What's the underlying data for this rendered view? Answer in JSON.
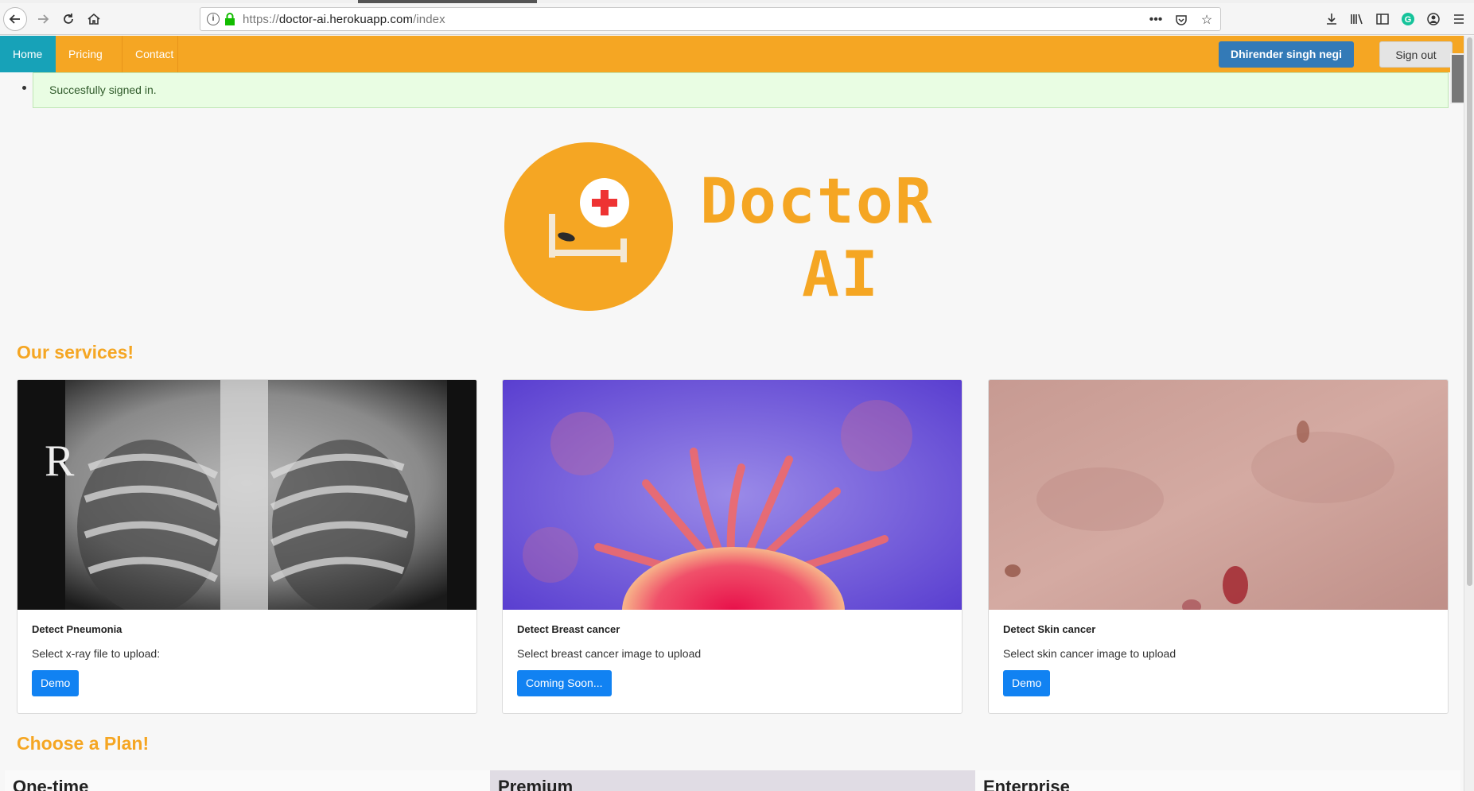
{
  "browser": {
    "url_scheme": "https://",
    "url_host": "doctor-ai.herokuapp.com",
    "url_path": "/index",
    "icons": [
      "back-icon",
      "forward-icon",
      "reload-icon",
      "home-icon",
      "info-icon",
      "lock-icon",
      "more-icon",
      "pocket-icon",
      "star-icon",
      "download-icon",
      "library-icon",
      "sidebar-icon",
      "grammarly-icon",
      "account-icon",
      "menu-icon"
    ]
  },
  "navbar": {
    "home": "Home",
    "pricing": "Pricing",
    "contact": "Contact",
    "user": "Dhirender singh negi",
    "signout": "Sign out"
  },
  "alert": {
    "message": "Succesfully signed in."
  },
  "logo": {
    "line1": "DoctoR",
    "line2": "AI"
  },
  "services": {
    "title": "Our services!",
    "cards": [
      {
        "title": "Detect Pneumonia",
        "text": "Select x-ray file to upload:",
        "button": "Demo"
      },
      {
        "title": "Detect Breast cancer",
        "text": "Select breast cancer image to upload",
        "button": "Coming Soon..."
      },
      {
        "title": "Detect Skin cancer",
        "text": "Select skin cancer image to upload",
        "button": "Demo"
      }
    ]
  },
  "plans": {
    "title": "Choose a Plan!",
    "items": [
      "One-time",
      "Premium",
      "Enterprise"
    ]
  },
  "colors": {
    "accent": "#f5a623",
    "home_tab": "#17a2b8",
    "user_btn": "#337ab7",
    "card_btn": "#1182f2"
  }
}
